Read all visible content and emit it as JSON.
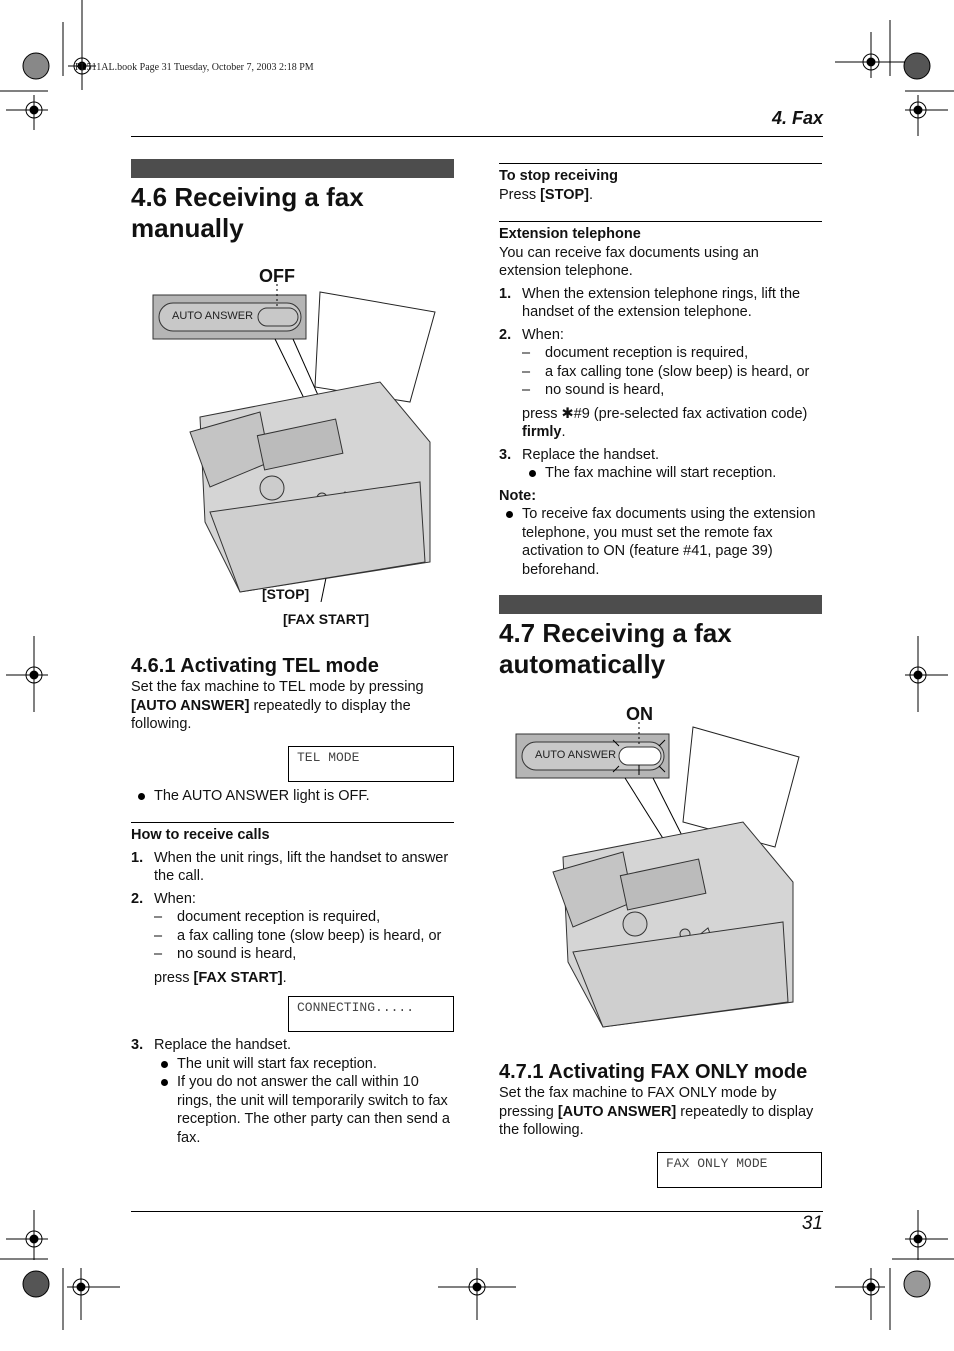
{
  "book_header": "FL511AL.book  Page 31  Tuesday, October 7, 2003  2:18 PM",
  "chapter": "4. Fax",
  "page_number": "31",
  "left": {
    "section_title": "4.6 Receiving a fax manually",
    "figure": {
      "indicator_label": "OFF",
      "panel_label": "AUTO ANSWER",
      "stop_label": "[STOP]",
      "fax_start_label": "[FAX START]"
    },
    "sub_title": "4.6.1 Activating TEL mode",
    "intro_1": "Set the fax machine to TEL mode by pressing ",
    "intro_key": "[AUTO ANSWER]",
    "intro_2": " repeatedly to display the following.",
    "lcd": "TEL MODE",
    "bullet": "The AUTO ANSWER light is OFF.",
    "how_heading": "How to receive calls",
    "step1": "When the unit rings, lift the handset to answer the call.",
    "step2": "When:",
    "dashes": [
      "document reception is required,",
      "a fax calling tone (slow beep) is heard, or",
      "no sound is heard,"
    ],
    "press_pre": "press ",
    "press_key": "[FAX START]",
    "press_post": ".",
    "lcd2": "CONNECTING.....",
    "step3": "Replace the handset.",
    "step3_bullets": [
      "The unit will start fax reception.",
      "If you do not answer the call within 10 rings, the unit will temporarily switch to fax reception. The other party can then send a fax."
    ]
  },
  "right": {
    "stop_heading": "To stop receiving",
    "stop_pre": "Press ",
    "stop_key": "[STOP]",
    "stop_post": ".",
    "ext_heading": "Extension telephone",
    "ext_intro": "You can receive fax documents using an extension telephone.",
    "step1": "When the extension telephone rings, lift the handset of the extension telephone.",
    "step2": "When:",
    "dashes": [
      "document reception is required,",
      "a fax calling tone (slow beep) is heard, or",
      "no sound is heard,"
    ],
    "press_pre": "press ",
    "press_code": "✱#9 (pre-selected fax activation code) ",
    "press_bold": "firmly",
    "press_post": ".",
    "step3": "Replace the handset.",
    "step3_bullet": "The fax machine will start reception.",
    "note_heading": "Note:",
    "note_bullet": "To receive fax documents using the extension telephone, you must set the remote fax activation to ON (feature #41, page 39) beforehand.",
    "section_title": "4.7 Receiving a fax automatically",
    "figure": {
      "indicator_label": "ON",
      "panel_label": "AUTO ANSWER"
    },
    "sub_title": "4.7.1 Activating FAX ONLY mode",
    "intro_1": "Set the fax machine to FAX ONLY mode by pressing ",
    "intro_key": "[AUTO ANSWER]",
    "intro_2": " repeatedly to display the following.",
    "lcd": "FAX ONLY MODE"
  },
  "step_numbers": [
    "1.",
    "2.",
    "3."
  ]
}
